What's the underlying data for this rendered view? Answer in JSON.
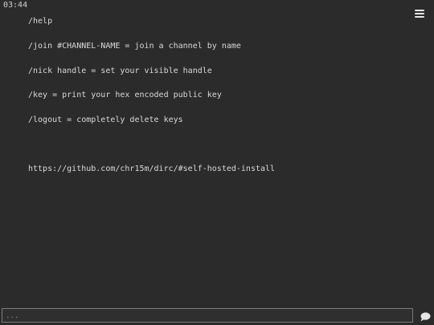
{
  "log": [
    {
      "time": "03:44",
      "lines": [
        "/help",
        "/join #CHANNEL-NAME = join a channel by name",
        "/nick handle = set your visible handle",
        "/key = print your hex encoded public key",
        "/logout = completely delete keys",
        "",
        "https://github.com/chr15m/dirc/#self-hosted-install"
      ]
    }
  ],
  "input": {
    "placeholder": "...",
    "value": ""
  },
  "icons": {
    "menu": "hamburger-menu-icon",
    "send": "speech-bubble-icon"
  },
  "colors": {
    "background": "#2b2b2b",
    "text": "#d8d8d8",
    "input_border": "#7a7a7a"
  }
}
